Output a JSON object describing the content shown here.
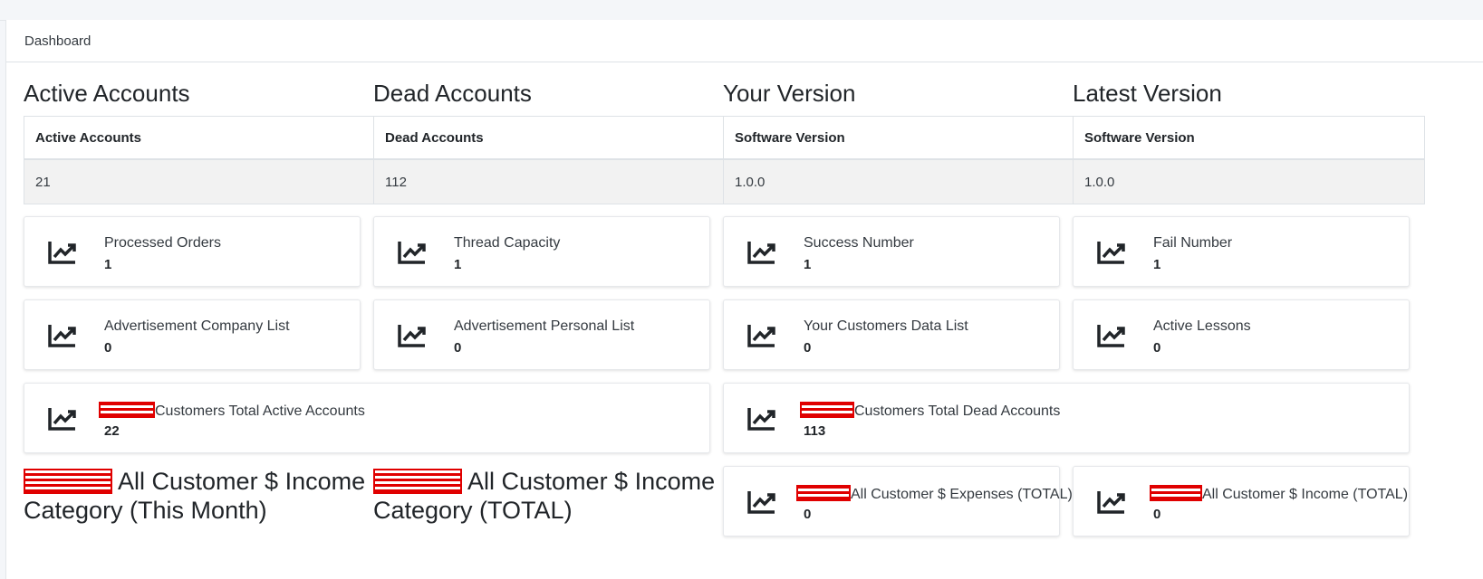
{
  "header": {
    "breadcrumb": "Dashboard"
  },
  "columns": [
    {
      "title": "Active Accounts",
      "table_header": "Active Accounts",
      "table_value": "21"
    },
    {
      "title": "Dead Accounts",
      "table_header": "Dead Accounts",
      "table_value": "112"
    },
    {
      "title": "Your Version",
      "table_header": "Software Version",
      "table_value": "1.0.0"
    },
    {
      "title": "Latest Version",
      "table_header": "Software Version",
      "table_value": "1.0.0"
    }
  ],
  "stats_row1": [
    {
      "label": "Processed Orders",
      "value": "1"
    },
    {
      "label": "Thread Capacity",
      "value": "1"
    },
    {
      "label": "Success Number",
      "value": "1"
    },
    {
      "label": "Fail Number",
      "value": "1"
    }
  ],
  "stats_row2": [
    {
      "label": "Advertisement Company List",
      "value": "0"
    },
    {
      "label": "Advertisement Personal List",
      "value": "0"
    },
    {
      "label": "Your Customers Data List",
      "value": "0"
    },
    {
      "label": "Active Lessons",
      "value": "0"
    }
  ],
  "stats_row3": [
    {
      "label": "Customers Total Active Accounts",
      "value": "22"
    },
    {
      "label": "Customers Total Dead Accounts",
      "value": "113"
    }
  ],
  "income_titles": [
    {
      "text": "All Customer $ Income Category (This Month)"
    },
    {
      "text": "All Customer $ Income Category (TOTAL)"
    }
  ],
  "stats_row4": [
    {
      "label": "All Customer $ Expenses (TOTAL)",
      "value": "0"
    },
    {
      "label": "All Customer $ Income (TOTAL)",
      "value": "0"
    }
  ],
  "icon": "chart-line-icon"
}
